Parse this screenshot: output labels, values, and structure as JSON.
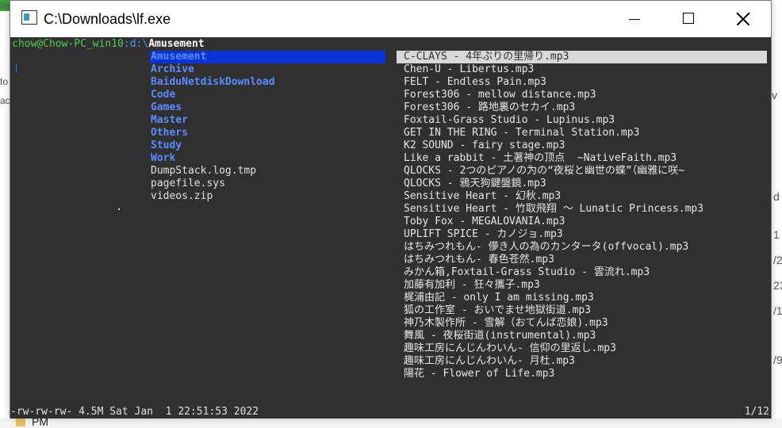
{
  "window": {
    "title": "C:\\Downloads\\lf.exe"
  },
  "prompt": {
    "user_host": "chow@Chow-PC_win10",
    "sep": ":",
    "path": "d:\\",
    "current": "Amusement"
  },
  "directory_list": [
    {
      "name": "Amusement",
      "type": "dir",
      "selected": true
    },
    {
      "name": "Archive",
      "type": "dir"
    },
    {
      "name": "BaiduNetdiskDownload",
      "type": "dir"
    },
    {
      "name": "Code",
      "type": "dir"
    },
    {
      "name": "Games",
      "type": "dir"
    },
    {
      "name": "Master",
      "type": "dir"
    },
    {
      "name": "Others",
      "type": "dir"
    },
    {
      "name": "Study",
      "type": "dir"
    },
    {
      "name": "Work",
      "type": "dir"
    },
    {
      "name": "DumpStack.log.tmp",
      "type": "file"
    },
    {
      "name": "pagefile.sys",
      "type": "file"
    },
    {
      "name": "videos.zip",
      "type": "file"
    }
  ],
  "preview_files": [
    "C-CLAYS - 4年ぶりの里帰り.mp3",
    "Chen-U - Libertus.mp3",
    "FELT - Endless Pain.mp3",
    "Forest306 - mellow distance.mp3",
    "Forest306 - 路地裏のセカイ.mp3",
    "Foxtail-Grass Studio - Lupinus.mp3",
    "GET IN THE RING - Terminal Station.mp3",
    "K2 SOUND - fairy stage.mp3",
    "Like a rabbit - 土著神の顶点  ~NativeFaith.mp3",
    "QLOCKS - 2つのピアノの为の“夜桜と幽世の蝶”（幽雅に咲~",
    "QLOCKS - 鴉天狗鍵盤鏡.mp3",
    "Sensitive Heart - 幻秋.mp3",
    "Sensitive Heart - 竹取飛翔 〜 Lunatic Princess.mp3",
    "Toby Fox - MEGALOVANIA.mp3",
    "UPLIFT SPICE - カノジョ.mp3",
    "はちみつれもん- 儚き人の為のカンタータ(offvocal).mp3",
    "はちみつれもん- 春色苍然.mp3",
    "みかん箱,Foxtail-Grass Studio - 雲流れ.mp3",
    "加藤有加利 - 狂々攜子.mp3",
    "梶浦由記 - only I am missing.mp3",
    "狐の工作室 - おいでませ地獄街道.mp3",
    "神乃木製作所 - 雪解（おてんば恋娘).mp3",
    "舞風 - 夜桜街道(instrumental).mp3",
    "趣味工房にんじんわいん- 信仰の里返し.mp3",
    "趣味工房にんじんわいん- 月杜.mp3",
    "陽花 - Flower of Life.mp3"
  ],
  "status": {
    "info": "-rw-rw-rw- 4.5M Sat Jan  1 22:51:53 2022",
    "position": "1/12"
  },
  "background_fragments": {
    "top_left": "ile",
    "left_1": "to",
    "left_2": "ac",
    "bottom_folder": "PM",
    "right_d": "d",
    "right_1": "1",
    "right_2": "/2",
    "right_3": "23",
    "right_4": "/1",
    "right_5": "/9",
    "right_v": "v"
  },
  "colors": {
    "terminal_bg": "#303030",
    "dir": "#5b8cff",
    "selection": "#0a34d8",
    "preview_highlight": "#d8d8d8",
    "user_host": "#4ec94e"
  }
}
